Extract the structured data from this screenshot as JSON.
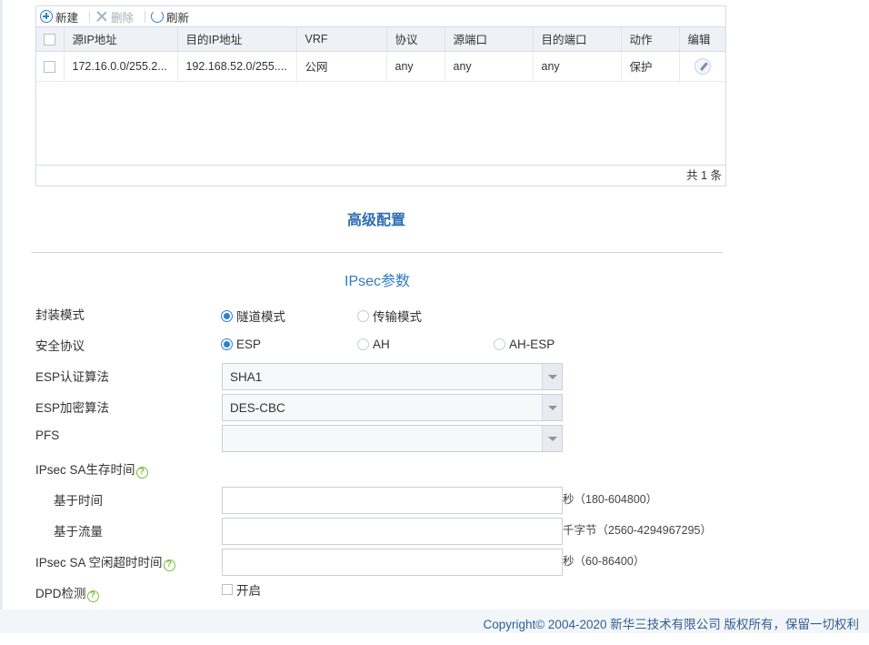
{
  "toolbar": {
    "new_label": "新建",
    "delete_label": "删除",
    "refresh_label": "刷新"
  },
  "acl_table": {
    "columns": [
      "源IP地址",
      "目的IP地址",
      "VRF",
      "协议",
      "源端口",
      "目的端口",
      "动作",
      "编辑"
    ],
    "rows": [
      {
        "src_ip": "172.16.0.0/255.2...",
        "dst_ip": "192.168.52.0/255....",
        "vrf": "公网",
        "protocol": "any",
        "src_port": "any",
        "dst_port": "any",
        "action": "保护"
      }
    ],
    "total_text": "共 1 条"
  },
  "advanced_title": "高级配置",
  "ipsec": {
    "section_title": "IPsec参数",
    "encap_mode": {
      "label": "封装模式",
      "options": [
        "隧道模式",
        "传输模式"
      ],
      "selected": "隧道模式"
    },
    "security_protocol": {
      "label": "安全协议",
      "options": [
        "ESP",
        "AH",
        "AH-ESP"
      ],
      "selected": "ESP"
    },
    "esp_auth": {
      "label": "ESP认证算法",
      "value": "SHA1"
    },
    "esp_enc": {
      "label": "ESP加密算法",
      "value": "DES-CBC"
    },
    "pfs": {
      "label": "PFS",
      "value": ""
    },
    "sa_lifetime": {
      "label": "IPsec SA生存时间"
    },
    "time_based": {
      "label": "基于时间",
      "value": "",
      "hint": "秒（180-604800）"
    },
    "traffic_based": {
      "label": "基于流量",
      "value": "",
      "hint": "千字节（2560-4294967295）"
    },
    "idle_timeout": {
      "label": "IPsec SA 空闲超时时间",
      "value": "",
      "hint": "秒（60-86400）"
    },
    "dpd": {
      "label": "DPD检测",
      "checkbox_label": "开启",
      "checked": false
    }
  },
  "copyright": "Copyright© 2004-2020 新华三技术有限公司 版权所有，保留一切权利"
}
